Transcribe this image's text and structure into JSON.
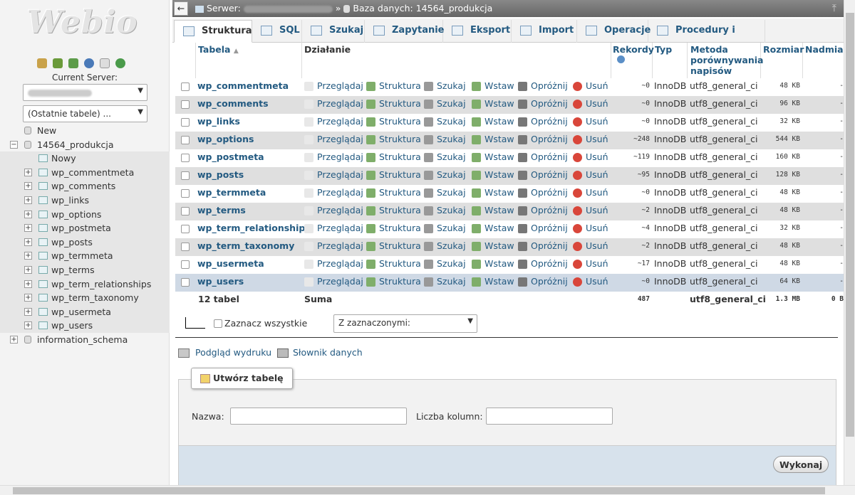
{
  "sidebar": {
    "logo_text": "Webio",
    "current_server_label": "Current Server:",
    "recent_tables_label": "(Ostatnie tabele) ...",
    "tree": {
      "new_label": "New",
      "db": "14564_produkcja",
      "db_new": "Nowy",
      "tables": [
        "wp_commentmeta",
        "wp_comments",
        "wp_links",
        "wp_options",
        "wp_postmeta",
        "wp_posts",
        "wp_termmeta",
        "wp_terms",
        "wp_term_relationships",
        "wp_term_taxonomy",
        "wp_usermeta",
        "wp_users"
      ],
      "other_db": "information_schema"
    }
  },
  "topbar": {
    "server_label": "Serwer:",
    "sep": "»",
    "db_label": "Baza danych: 14564_produkcja"
  },
  "tabs": [
    "Struktura",
    "SQL",
    "Szukaj",
    "Zapytanie",
    "Eksport",
    "Import",
    "Operacje",
    "Procedury i funkcje"
  ],
  "headers": {
    "tabela": "Tabela",
    "dzialanie": "Działanie",
    "rekordy": "Rekordy",
    "typ": "Typ",
    "metoda": "Metoda porównywania napisów",
    "rozmiar": "Rozmiar",
    "nadmiar": "Nadmiar"
  },
  "actions": {
    "browse": "Przeglądaj",
    "structure": "Struktura",
    "search": "Szukaj",
    "insert": "Wstaw",
    "empty": "Opróżnij",
    "drop": "Usuń"
  },
  "rows": [
    {
      "name": "wp_commentmeta",
      "records": "~0",
      "type": "InnoDB",
      "collation": "utf8_general_ci",
      "size": "48 KB",
      "overhead": "-"
    },
    {
      "name": "wp_comments",
      "records": "~0",
      "type": "InnoDB",
      "collation": "utf8_general_ci",
      "size": "96 KB",
      "overhead": "-"
    },
    {
      "name": "wp_links",
      "records": "~0",
      "type": "InnoDB",
      "collation": "utf8_general_ci",
      "size": "32 KB",
      "overhead": "-"
    },
    {
      "name": "wp_options",
      "records": "~248",
      "type": "InnoDB",
      "collation": "utf8_general_ci",
      "size": "544 KB",
      "overhead": "-"
    },
    {
      "name": "wp_postmeta",
      "records": "~119",
      "type": "InnoDB",
      "collation": "utf8_general_ci",
      "size": "160 KB",
      "overhead": "-"
    },
    {
      "name": "wp_posts",
      "records": "~95",
      "type": "InnoDB",
      "collation": "utf8_general_ci",
      "size": "128 KB",
      "overhead": "-"
    },
    {
      "name": "wp_termmeta",
      "records": "~0",
      "type": "InnoDB",
      "collation": "utf8_general_ci",
      "size": "48 KB",
      "overhead": "-"
    },
    {
      "name": "wp_terms",
      "records": "~2",
      "type": "InnoDB",
      "collation": "utf8_general_ci",
      "size": "48 KB",
      "overhead": "-"
    },
    {
      "name": "wp_term_relationships",
      "records": "~4",
      "type": "InnoDB",
      "collation": "utf8_general_ci",
      "size": "32 KB",
      "overhead": "-"
    },
    {
      "name": "wp_term_taxonomy",
      "records": "~2",
      "type": "InnoDB",
      "collation": "utf8_general_ci",
      "size": "48 KB",
      "overhead": "-"
    },
    {
      "name": "wp_usermeta",
      "records": "~17",
      "type": "InnoDB",
      "collation": "utf8_general_ci",
      "size": "48 KB",
      "overhead": "-"
    },
    {
      "name": "wp_users",
      "records": "~0",
      "type": "InnoDB",
      "collation": "utf8_general_ci",
      "size": "64 KB",
      "overhead": "-"
    }
  ],
  "summary": {
    "count": "12 tabel",
    "label": "Suma",
    "records": "487",
    "collation": "utf8_general_ci",
    "size": "1.3 MB",
    "overhead": "0 B"
  },
  "bulk": {
    "check_all": "Zaznacz wszystkie",
    "with_selected": "Z zaznaczonymi:"
  },
  "links": {
    "print": "Podgląd wydruku",
    "dictionary": "Słownik danych"
  },
  "create": {
    "legend": "Utwórz tabelę",
    "name_label": "Nazwa:",
    "cols_label": "Liczba kolumn:",
    "submit": "Wykonaj"
  }
}
